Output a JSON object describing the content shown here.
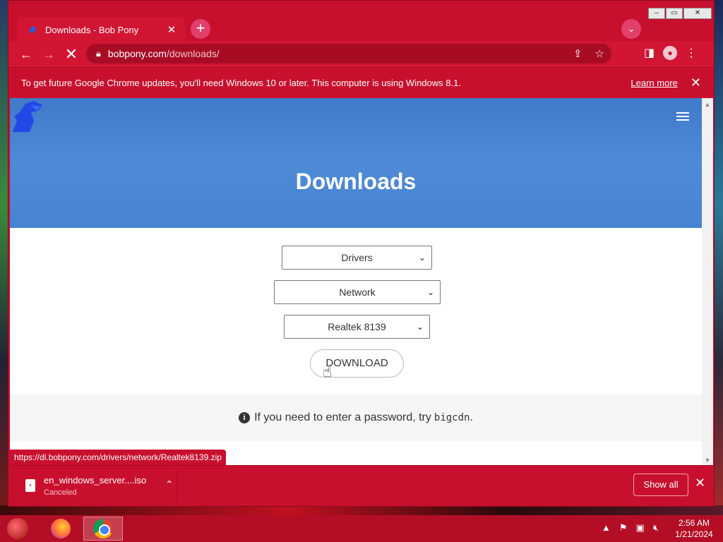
{
  "browser": {
    "tab_title": "Downloads - Bob Pony",
    "tab_close": "✕",
    "new_tab": "+",
    "tab_search": "⌄",
    "url_host": "bobpony.com",
    "url_path": "/downloads/",
    "window_controls": {
      "minimize": "–",
      "maximize": "▭",
      "close": "✕"
    }
  },
  "infobar": {
    "message": "To get future Google Chrome updates, you'll need Windows 10 or later. This computer is using Windows 8.1.",
    "link": "Learn more",
    "close": "✕"
  },
  "page": {
    "title": "Downloads",
    "category_select": "Drivers",
    "subcategory_select": "Network",
    "item_select": "Realtek 8139",
    "download_button": "DOWNLOAD",
    "notice_text": "If you need to enter a password, try",
    "notice_code": "bigcdn",
    "notice_end": "."
  },
  "status_url": "https://dl.bobpony.com/drivers/network/Realtek8139.zip",
  "download_bar": {
    "file_name": "en_windows_server....iso",
    "file_status": "Canceled",
    "show_all": "Show all",
    "close": "✕"
  },
  "taskbar": {
    "time": "2:56 AM",
    "date": "1/21/2024"
  },
  "icons": {
    "back": "arrow-left-icon",
    "forward": "arrow-right-icon",
    "stop": "stop-icon",
    "lock": "lock-icon",
    "share": "share-icon",
    "bookmark": "star-icon",
    "side_panel": "side-panel-icon",
    "profile": "profile-icon",
    "menu": "more-vert-icon"
  },
  "colors": {
    "chrome_red": "#c8102e",
    "hero_blue": "#4684d2"
  }
}
